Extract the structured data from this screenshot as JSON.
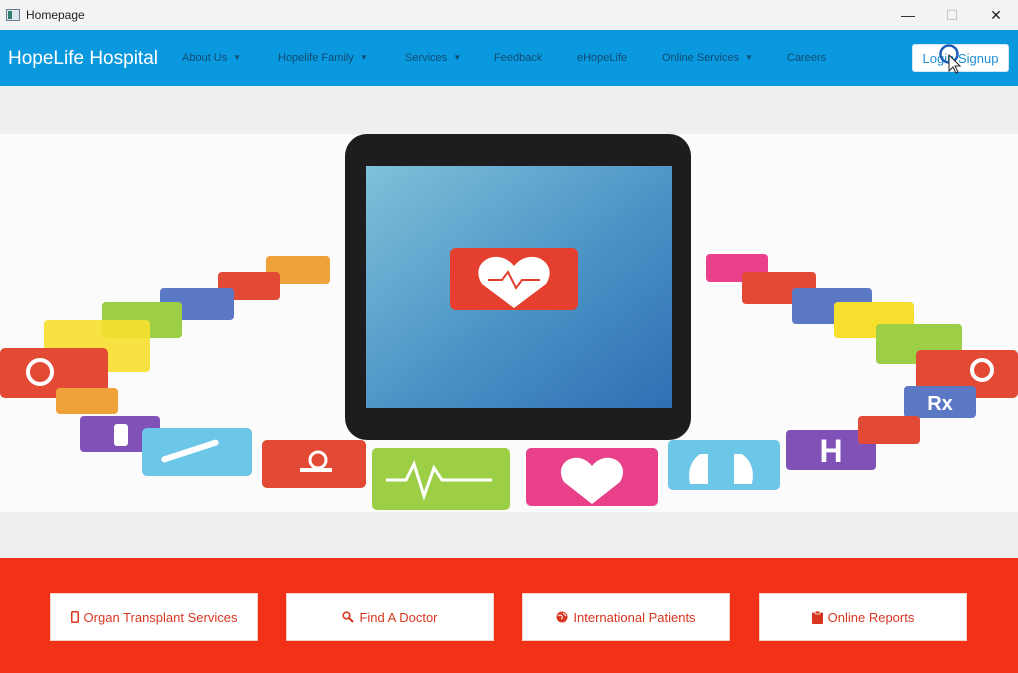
{
  "window": {
    "title": "Homepage",
    "controls": {
      "minimize": "—",
      "maximize": "☐",
      "close": "✕"
    }
  },
  "navbar": {
    "brand": "HopeLife Hospital",
    "items": [
      {
        "label": "About Us",
        "dropdown": true
      },
      {
        "label": "Hopelife Family",
        "dropdown": true
      },
      {
        "label": "Services",
        "dropdown": true
      },
      {
        "label": "Feedback",
        "dropdown": false
      },
      {
        "label": "eHopeLife",
        "dropdown": false
      },
      {
        "label": "Online Services",
        "dropdown": true
      },
      {
        "label": "Careers",
        "dropdown": false
      }
    ],
    "caret": "▼",
    "login_label": "Login/Signup"
  },
  "quicklinks": [
    {
      "label": "Organ Transplant Services",
      "icon": "mobile-icon"
    },
    {
      "label": "Find A Doctor",
      "icon": "search-icon"
    },
    {
      "label": "International Patients",
      "icon": "globe-icon"
    },
    {
      "label": "Online Reports",
      "icon": "clipboard-icon"
    }
  ],
  "colors": {
    "navbar": "#0a98de",
    "quicklinks_bg": "#f23218",
    "accent_text": "#d9361f"
  }
}
